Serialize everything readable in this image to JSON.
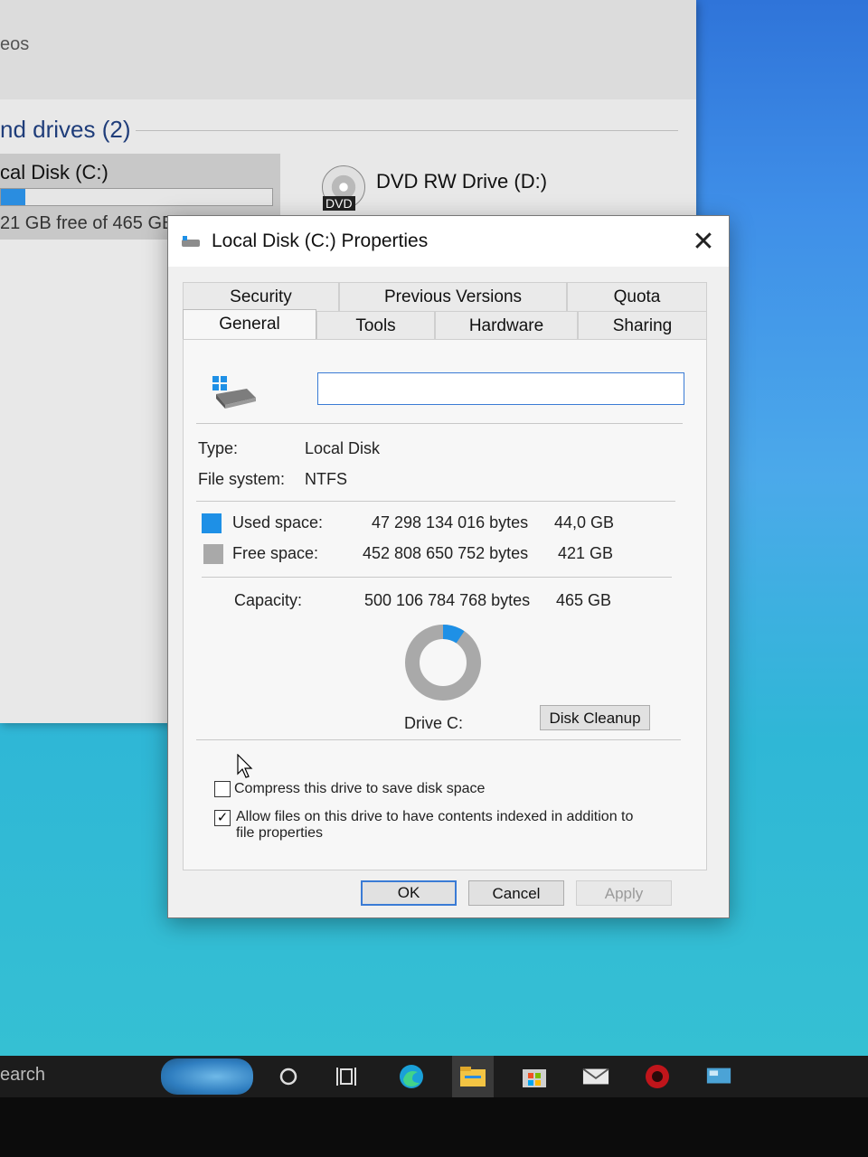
{
  "explorer": {
    "videos_label": "eos",
    "section_header": "nd drives (2)",
    "drive_c": {
      "name": "cal Disk (C:)",
      "free_text": "21 GB free of 465 GB",
      "used_fraction": 0.09
    },
    "drive_d": {
      "name": "DVD RW Drive (D:)",
      "badge": "DVD"
    }
  },
  "dialog": {
    "title": "Local Disk (C:) Properties",
    "close_glyph": "✕",
    "tabs_row1": [
      "Security",
      "Previous Versions",
      "Quota"
    ],
    "tabs_row2": [
      "General",
      "Tools",
      "Hardware",
      "Sharing"
    ],
    "active_tab": "General",
    "name_value": "",
    "type_label": "Type:",
    "type_value": "Local Disk",
    "fs_label": "File system:",
    "fs_value": "NTFS",
    "used_label": "Used space:",
    "used_bytes": "47 298 134 016 bytes",
    "used_gb": "44,0 GB",
    "free_label": "Free space:",
    "free_bytes": "452 808 650 752 bytes",
    "free_gb": "421 GB",
    "capacity_label": "Capacity:",
    "capacity_bytes": "500 106 784 768 bytes",
    "capacity_gb": "465 GB",
    "used_fraction": 0.0946,
    "drive_label": "Drive C:",
    "cleanup_button": "Disk Cleanup",
    "compress_label": "Compress this drive to save disk space",
    "compress_checked": false,
    "index_label_line1": "Allow files on this drive to have contents indexed in addition to",
    "index_label_line2": "file properties",
    "index_checked": true,
    "ok_button": "OK",
    "cancel_button": "Cancel",
    "apply_button": "Apply"
  },
  "colors": {
    "used": "#1e90e6",
    "free": "#a9a9a9"
  },
  "taskbar": {
    "search_text": "earch",
    "icons": [
      "task-view-icon",
      "cortana-circle-icon",
      "edge-icon",
      "file-explorer-icon",
      "store-icon",
      "mail-icon",
      "red-app-icon",
      "monitor-app-icon"
    ]
  }
}
